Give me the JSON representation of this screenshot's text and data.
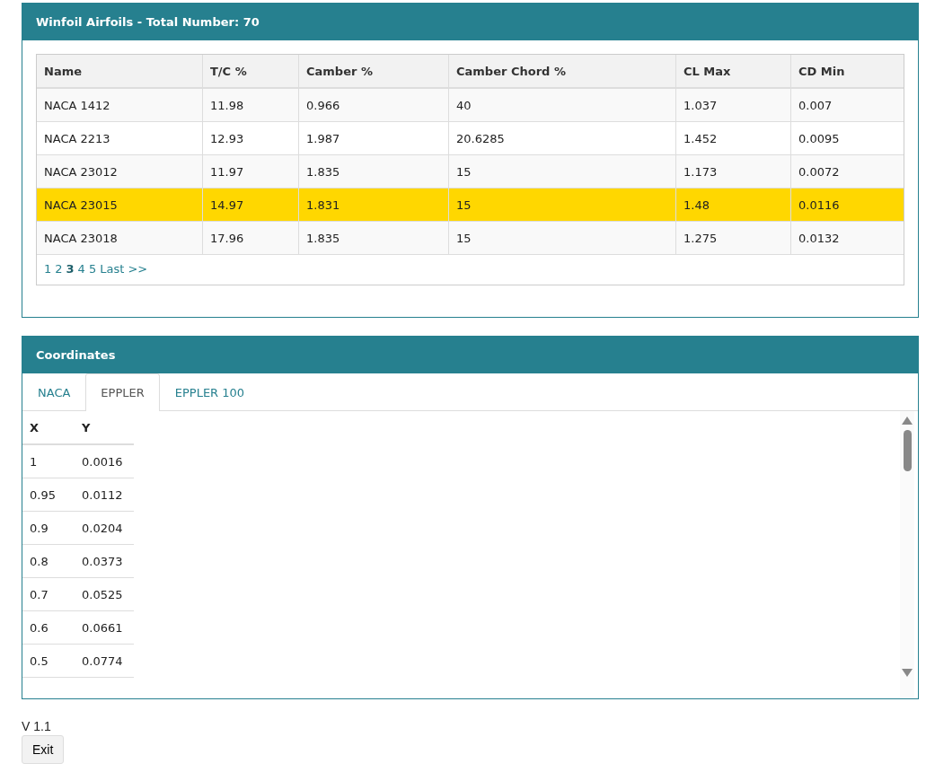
{
  "airfoils_panel": {
    "title": "Winfoil Airfoils - Total Number: 70",
    "table": {
      "columns": [
        "Name",
        "T/C %",
        "Camber %",
        "Camber Chord %",
        "CL Max",
        "CD Min"
      ],
      "rows": [
        {
          "cells": [
            "NACA 1412",
            "11.98",
            "0.966",
            "40",
            "1.037",
            "0.007"
          ],
          "selected": false
        },
        {
          "cells": [
            "NACA 2213",
            "12.93",
            "1.987",
            "20.6285",
            "1.452",
            "0.0095"
          ],
          "selected": false
        },
        {
          "cells": [
            "NACA 23012",
            "11.97",
            "1.835",
            "15",
            "1.173",
            "0.0072"
          ],
          "selected": false
        },
        {
          "cells": [
            "NACA 23015",
            "14.97",
            "1.831",
            "15",
            "1.48",
            "0.0116"
          ],
          "selected": true
        },
        {
          "cells": [
            "NACA 23018",
            "17.96",
            "1.835",
            "15",
            "1.275",
            "0.0132"
          ],
          "selected": false
        }
      ]
    },
    "pager": {
      "pages": [
        {
          "label": "1",
          "selected": false
        },
        {
          "label": "2",
          "selected": false
        },
        {
          "label": "3",
          "selected": true
        },
        {
          "label": "4",
          "selected": false
        },
        {
          "label": "5",
          "selected": false
        }
      ],
      "last": "Last >>"
    }
  },
  "coordinates_panel": {
    "title": "Coordinates",
    "tabs": [
      {
        "label": "NACA",
        "selected": false
      },
      {
        "label": "EPPLER",
        "selected": true
      },
      {
        "label": "EPPLER 100",
        "selected": false
      }
    ],
    "table": {
      "columns": [
        "X",
        "Y"
      ],
      "rows": [
        [
          "1",
          "0.0016"
        ],
        [
          "0.95",
          "0.0112"
        ],
        [
          "0.9",
          "0.0204"
        ],
        [
          "0.8",
          "0.0373"
        ],
        [
          "0.7",
          "0.0525"
        ],
        [
          "0.6",
          "0.0661"
        ],
        [
          "0.5",
          "0.0774"
        ]
      ]
    }
  },
  "version": "V 1.1",
  "exit_button": "Exit"
}
